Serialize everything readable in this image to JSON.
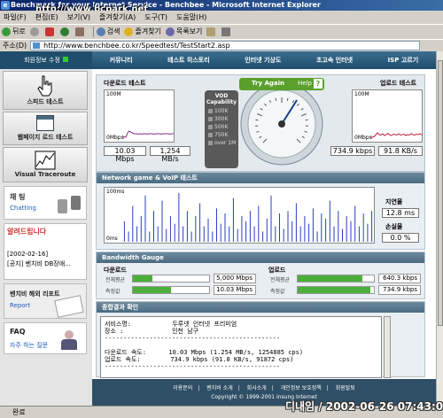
{
  "window": {
    "title": "Benchmark for your Internet Service - Benchbee - Microsoft Internet Explorer",
    "watermark": "http://www.bcpark.net"
  },
  "menubar": {
    "items": [
      "파일(F)",
      "편집(E)",
      "보기(V)",
      "즐겨찾기(A)",
      "도구(T)",
      "도움말(H)"
    ]
  },
  "toolbar": {
    "back": "뒤로",
    "search": "검색",
    "favorites": "즐겨찾기",
    "history": "목록보기"
  },
  "address": {
    "label": "주소(D)",
    "url": "http://www.benchbee.co.kr/Speedtest/TestStart2.asp"
  },
  "header": {
    "member_label": "회원정보 수정",
    "nav": [
      "커뮤니티",
      "테스트 히스토리",
      "인터넷 기상도",
      "초고속 인터넷",
      "ISP 고르기"
    ]
  },
  "sidebar": {
    "speed_test": "스피드 테스트",
    "webpage_load_test": "웹페이지 로드 테스트",
    "visual_traceroute": "Visual Traceroute",
    "chatting_ko": "채 팅",
    "chatting_en": "Chatting",
    "notice_title": "알려드립니다",
    "notice_date": "[2002-02-16]",
    "notice_text": "[공지] 벤치비 DB장애...",
    "overseas_report": "벤치비 해외 리포트",
    "report_label": "Report",
    "faq_title": "FAQ",
    "faq_text": "자주 하는 질문"
  },
  "download_test": {
    "title": "다운로드 테스트",
    "graph_top": "100M",
    "graph_bottom": "0Mbps",
    "speed_mbps": "10.03 Mbps",
    "speed_mbs": "1,254 MB/s",
    "points": [
      0.02,
      0.03,
      0.02,
      0.12,
      0.16,
      0.13,
      0.11,
      0.1,
      0.1,
      0.09,
      0.1,
      0.09,
      0.1,
      0.1,
      0.09,
      0.1,
      0.1,
      0.1,
      0.09,
      0.1,
      0.1,
      0.1,
      0.09,
      0.1,
      0.1,
      0.1,
      0.1,
      0.09,
      0.1,
      0.1
    ]
  },
  "upload_test": {
    "title": "업로드 테스트",
    "graph_top": "100M",
    "graph_bottom": "0Mbps",
    "speed_kbps": "734.9 kbps",
    "speed_kbs": "91.8 KB/s",
    "points": [
      0.02,
      0.02,
      0.03,
      0.07,
      0.12,
      0.08,
      0.07,
      0.1,
      0.06,
      0.08,
      0.11,
      0.07,
      0.06,
      0.09,
      0.08,
      0.07,
      0.1,
      0.07,
      0.08,
      0.09,
      0.06,
      0.08,
      0.07,
      0.1,
      0.08,
      0.07,
      0.09,
      0.08,
      0.1,
      0.07
    ]
  },
  "gauge": {
    "try_again": "Try Again",
    "help": "Help",
    "help_icon": "?",
    "value_fraction": 0.62
  },
  "vod": {
    "title": "VOD Capability",
    "levels": [
      "100K",
      "300K",
      "500K",
      "750K",
      "over 1M"
    ]
  },
  "network": {
    "title": "Network game & VoIP 테스트",
    "graph_top": "100ms",
    "graph_bottom": "0ms",
    "latency_label": "지연율",
    "latency_value": "12.8 ms",
    "loss_label": "손실율",
    "loss_value": "0.0 %",
    "spikes": [
      0.4,
      0.2,
      0.7,
      0.3,
      0.5,
      0.9,
      0.2,
      0.6,
      0.3,
      0.8,
      0.25,
      0.5,
      0.35,
      0.95,
      0.3,
      0.6,
      0.2,
      0.5,
      0.75,
      0.3,
      0.45,
      0.2,
      0.65,
      0.35,
      0.55,
      0.3,
      0.85,
      0.25,
      0.5,
      0.4,
      0.6,
      0.3,
      0.7,
      0.2,
      0.45,
      0.9,
      0.3,
      0.55,
      0.25,
      0.6,
      0.4,
      0.75,
      0.3,
      0.5,
      0.35,
      0.65,
      0.2,
      0.55,
      0.45,
      0.8,
      0.3,
      0.6,
      0.25,
      0.5,
      0.4,
      0.7,
      0.3,
      0.55,
      0.35,
      0.6
    ]
  },
  "bandwidth": {
    "title": "Bandwidth Gauge",
    "download": {
      "title": "다운로드",
      "avg_label": "전체평균",
      "avg_value": "5,000 Mbps",
      "avg_fraction": 0.25,
      "measured_label": "측정값",
      "measured_value": "10.03 Mbps",
      "measured_fraction": 0.5
    },
    "upload": {
      "title": "업로드",
      "avg_label": "전체평균",
      "avg_value": "640.3 kbps",
      "avg_fraction": 0.85,
      "measured_label": "측정값",
      "measured_value": "734.9 kbps",
      "measured_fraction": 0.95
    }
  },
  "summary": {
    "title": "종합결과 확인",
    "text": "서비스명:           두루넷 인터넷 프리미엄\n장소 :             인천 남구\n-----------------------------------------------\n\n다운로드 속도:      10.03 Mbps (1.254 MB/s, 1254885 cps)\n업로드 속도:        734.9 kbps (91.8 KB/s, 91872 cps)\n-----------------------------------------------"
  },
  "footer": {
    "links": [
      "이용문의",
      "벤치비 소개",
      "회사소개",
      "개인정보 보호정책",
      "회원탈퇴"
    ],
    "copyright": "Copyright © 1999-2001 Insung Internet"
  },
  "statusbar": {
    "text": "완료"
  },
  "stamp": {
    "text": "디내임 / 2002-06-26 07:43:02"
  }
}
